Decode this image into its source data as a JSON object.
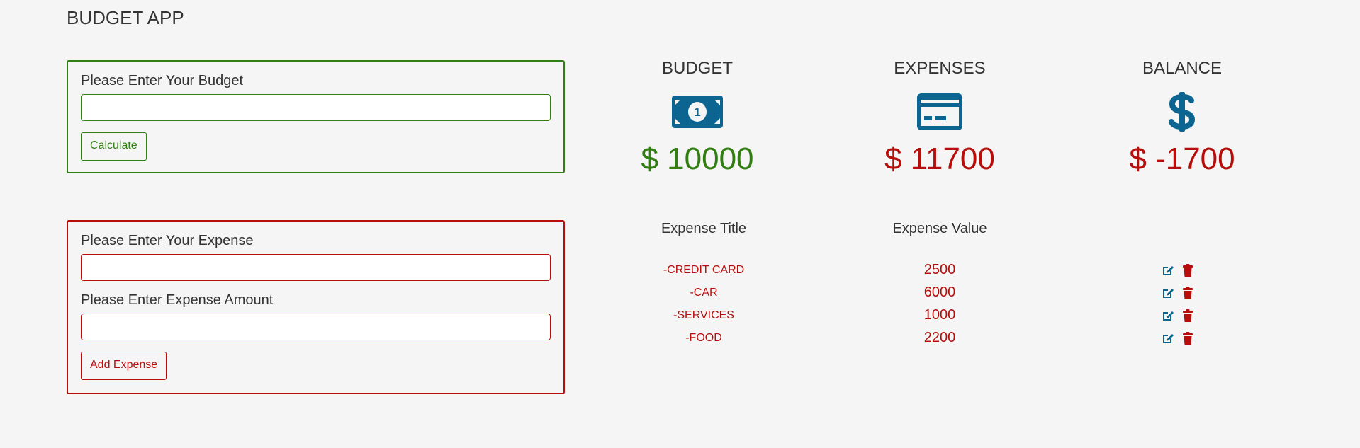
{
  "app": {
    "title": "BUDGET APP"
  },
  "budget_form": {
    "label": "Please Enter Your Budget",
    "input_value": "",
    "button_label": "Calculate"
  },
  "expense_form": {
    "title_label": "Please Enter Your Expense",
    "title_value": "",
    "amount_label": "Please Enter Expense Amount",
    "amount_value": "",
    "button_label": "Add Expense"
  },
  "summary": {
    "budget": {
      "title": "BUDGET",
      "amount": "$ 10000",
      "icon": "money-bill-icon"
    },
    "expenses": {
      "title": "EXPENSES",
      "amount": "$ 11700",
      "icon": "credit-card-icon"
    },
    "balance": {
      "title": "BALANCE",
      "amount": "$ -1700",
      "icon": "dollar-sign-icon"
    }
  },
  "expense_list": {
    "headers": {
      "title": "Expense Title",
      "value": "Expense Value"
    },
    "items": [
      {
        "title": "-CREDIT CARD",
        "value": "2500"
      },
      {
        "title": "-CAR",
        "value": "6000"
      },
      {
        "title": "-SERVICES",
        "value": "1000"
      },
      {
        "title": "-FOOD",
        "value": "2200"
      }
    ]
  },
  "colors": {
    "green": "#317f13",
    "red": "#b70e0c",
    "icon_blue": "#0c6590",
    "background": "#f5f5f5"
  }
}
